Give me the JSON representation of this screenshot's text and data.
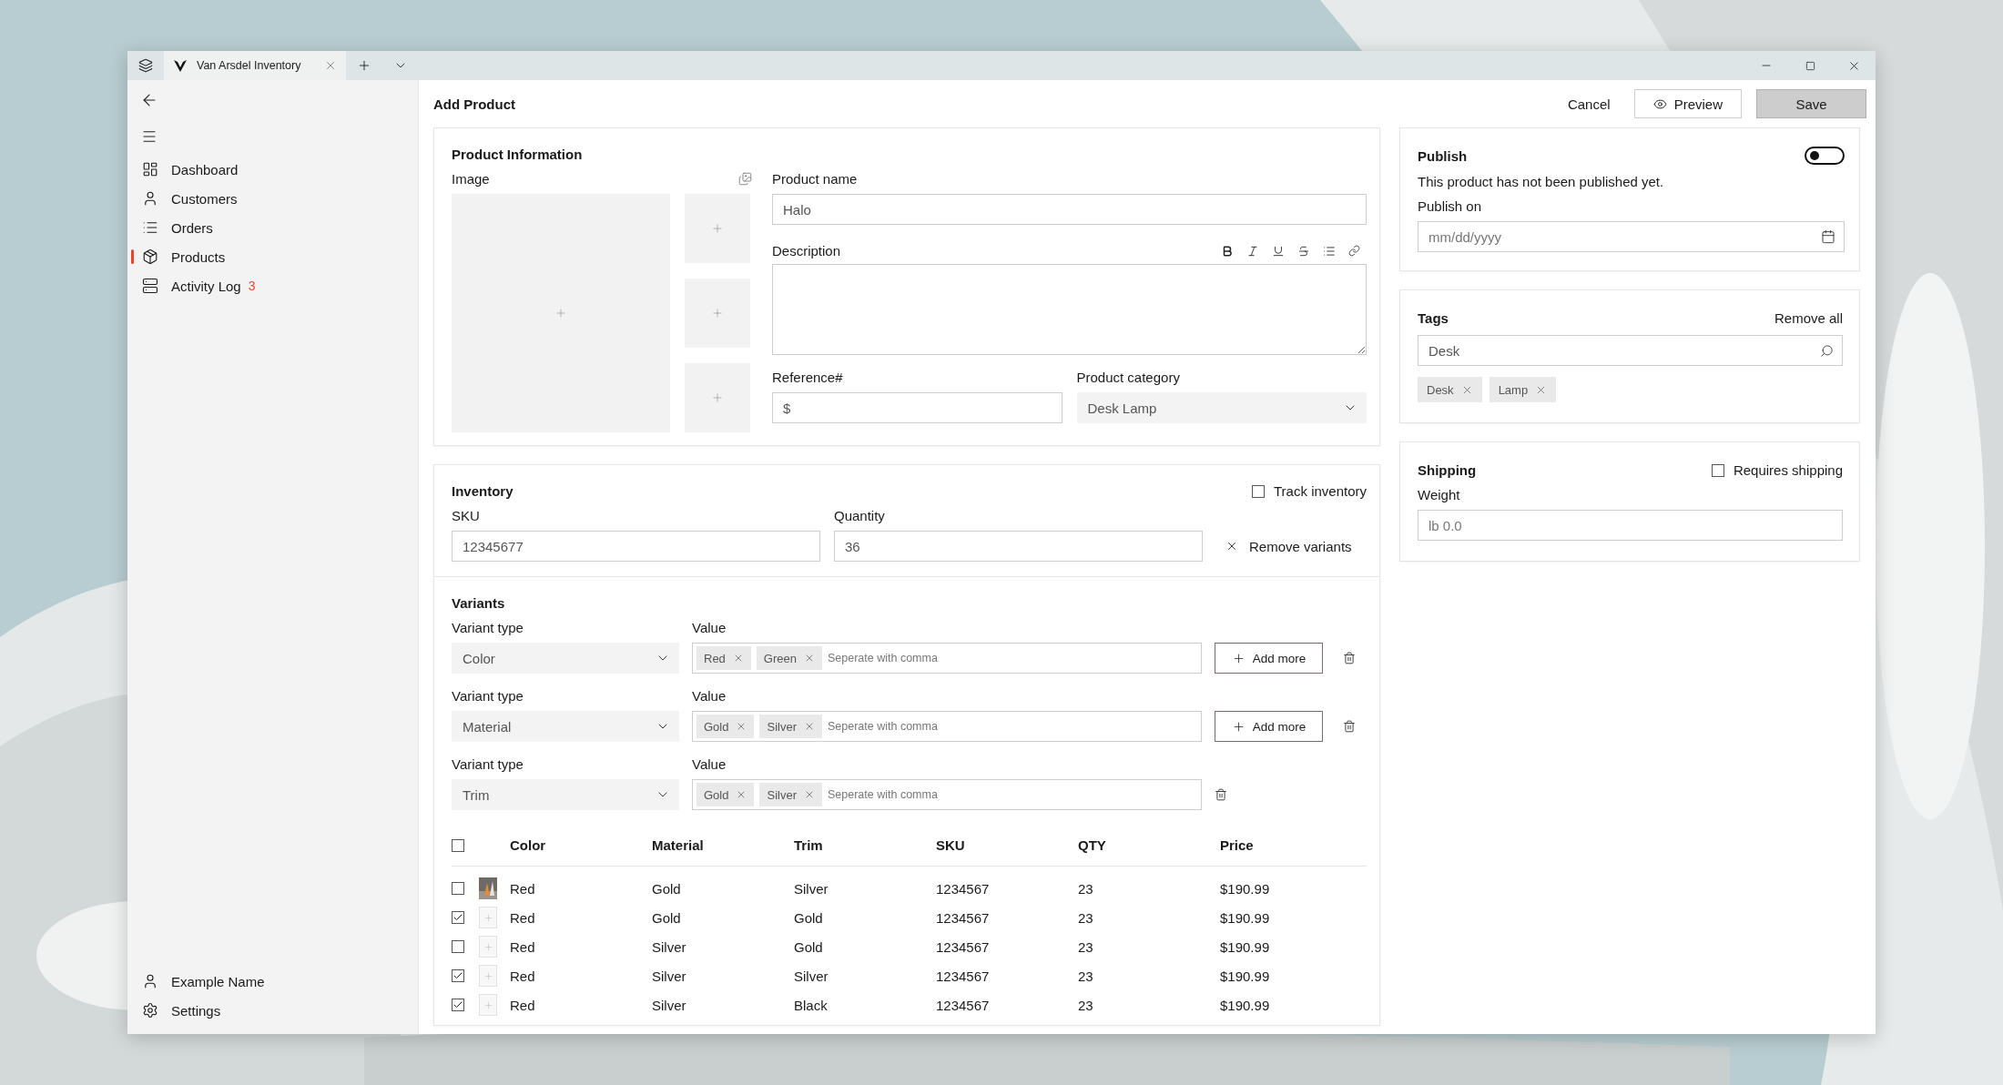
{
  "browser_tab": {
    "title": "Van Arsdel Inventory"
  },
  "nav": {
    "items": [
      {
        "label": "Dashboard",
        "selected": false
      },
      {
        "label": "Customers",
        "selected": false
      },
      {
        "label": "Orders",
        "selected": false
      },
      {
        "label": "Products",
        "selected": true
      },
      {
        "label": "Activity Log",
        "selected": false,
        "badge": "3"
      }
    ],
    "footer": [
      {
        "label": "Example Name"
      },
      {
        "label": "Settings"
      }
    ]
  },
  "page": {
    "title": "Add Product",
    "cancel": "Cancel",
    "preview": "Preview",
    "save": "Save"
  },
  "product_info": {
    "title": "Product Information",
    "image_label": "Image",
    "product_name": {
      "label": "Product name",
      "value": "Halo"
    },
    "description": {
      "label": "Description"
    },
    "reference": {
      "label": "Reference#",
      "value": "$"
    },
    "category": {
      "label": "Product category",
      "value": "Desk Lamp"
    }
  },
  "inventory": {
    "title": "Inventory",
    "track": {
      "label": "Track inventory",
      "checked": false
    },
    "sku": {
      "label": "SKU",
      "value": "12345677"
    },
    "quantity": {
      "label": "Quantity",
      "value": "36"
    },
    "remove_variants": "Remove variants"
  },
  "variants": {
    "title": "Variants",
    "rows": [
      {
        "type_label": "Variant type",
        "type": "Color",
        "value_label": "Value",
        "chips": [
          "Red",
          "Green"
        ],
        "placeholder": "Seperate with comma",
        "add_more": "Add more"
      },
      {
        "type_label": "Variant type",
        "type": "Material",
        "value_label": "Value",
        "chips": [
          "Gold",
          "Silver"
        ],
        "placeholder": "Seperate with comma",
        "add_more": "Add more"
      },
      {
        "type_label": "Variant type",
        "type": "Trim",
        "value_label": "Value",
        "chips": [
          "Gold",
          "Silver"
        ],
        "placeholder": "Seperate with comma"
      }
    ]
  },
  "table": {
    "all_checked": false,
    "columns": [
      "Color",
      "Material",
      "Trim",
      "SKU",
      "QTY",
      "Price"
    ],
    "rows": [
      {
        "checked": false,
        "kind": "picture",
        "cells": [
          "Red",
          "Gold",
          "Silver",
          "1234567",
          "23",
          "$190.99"
        ]
      },
      {
        "checked": true,
        "kind": "empty",
        "cells": [
          "Red",
          "Gold",
          "Gold",
          "1234567",
          "23",
          "$190.99"
        ]
      },
      {
        "checked": false,
        "kind": "empty",
        "cells": [
          "Red",
          "Silver",
          "Gold",
          "1234567",
          "23",
          "$190.99"
        ]
      },
      {
        "checked": true,
        "kind": "empty",
        "cells": [
          "Red",
          "Silver",
          "Silver",
          "1234567",
          "23",
          "$190.99"
        ]
      },
      {
        "checked": true,
        "kind": "empty",
        "cells": [
          "Red",
          "Silver",
          "Black",
          "1234567",
          "23",
          "$190.99"
        ]
      }
    ]
  },
  "publish": {
    "title": "Publish",
    "on": false,
    "note": "This product has not been published yet.",
    "date_label": "Publish on",
    "date_placeholder": "mm/dd/yyyy"
  },
  "tags": {
    "title": "Tags",
    "remove_all": "Remove all",
    "value": "Desk",
    "chips": [
      "Desk",
      "Lamp"
    ]
  },
  "shipping": {
    "title": "Shipping",
    "requires": {
      "label": "Requires shipping",
      "checked": false
    },
    "weight_label": "Weight",
    "weight_placeholder": "lb 0.0"
  }
}
